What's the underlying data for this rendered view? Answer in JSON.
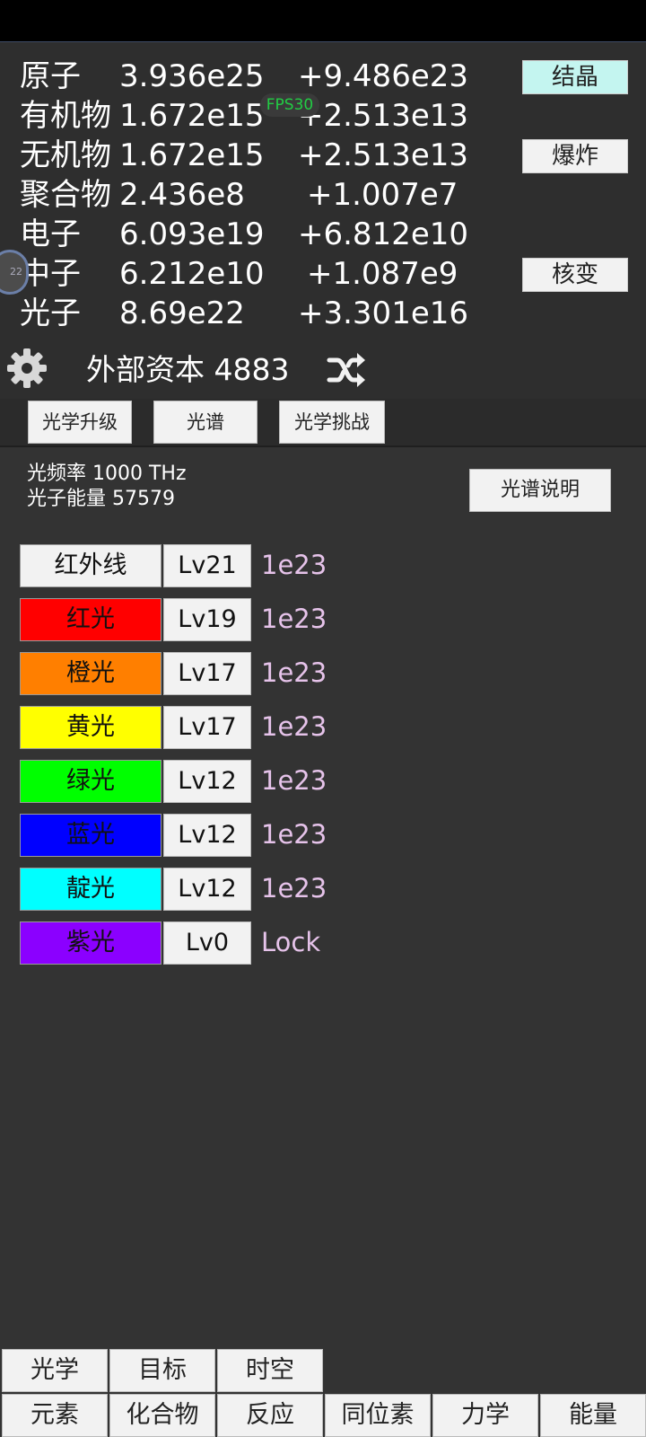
{
  "resources": [
    {
      "name": "原子",
      "value": "3.936e25",
      "rate": "+9.486e23"
    },
    {
      "name": "有机物",
      "value": "1.672e15",
      "rate": "+2.513e13"
    },
    {
      "name": "无机物",
      "value": "1.672e15",
      "rate": "+2.513e13"
    },
    {
      "name": "聚合物",
      "value": "2.436e8",
      "rate": "+1.007e7"
    },
    {
      "name": "电子",
      "value": "6.093e19",
      "rate": "+6.812e10"
    },
    {
      "name": "中子",
      "value": "6.212e10",
      "rate": "+1.087e9"
    },
    {
      "name": "光子",
      "value": "8.69e22",
      "rate": "+3.301e16"
    }
  ],
  "side_buttons": {
    "crystal": "结晶",
    "explode": "爆炸",
    "nuclear": "核变"
  },
  "fps": "FPS30",
  "float_ball": "22",
  "capital": {
    "label": "外部资本",
    "value": "4883"
  },
  "subtabs": [
    "光学升级",
    "光谱",
    "光学挑战"
  ],
  "info": {
    "frequency": "光频率 1000 THz",
    "energy": "光子能量 57579"
  },
  "explain_button": "光谱说明",
  "lights": [
    {
      "name": "红外线",
      "level": "Lv21",
      "cost": "1e23",
      "color": "#f2f2f2"
    },
    {
      "name": "红光",
      "level": "Lv19",
      "cost": "1e23",
      "color": "#ff0000"
    },
    {
      "name": "橙光",
      "level": "Lv17",
      "cost": "1e23",
      "color": "#ff7f00"
    },
    {
      "name": "黄光",
      "level": "Lv17",
      "cost": "1e23",
      "color": "#ffff00"
    },
    {
      "name": "绿光",
      "level": "Lv12",
      "cost": "1e23",
      "color": "#00ff00"
    },
    {
      "name": "蓝光",
      "level": "Lv12",
      "cost": "1e23",
      "color": "#0000ff"
    },
    {
      "name": "靛光",
      "level": "Lv12",
      "cost": "1e23",
      "color": "#00ffff"
    },
    {
      "name": "紫光",
      "level": "Lv0",
      "cost": "Lock",
      "color": "#8b00ff"
    }
  ],
  "bottom_nav_row1": [
    "光学",
    "目标",
    "时空"
  ],
  "bottom_nav_row2": [
    "元素",
    "化合物",
    "反应",
    "同位素",
    "力学",
    "能量"
  ]
}
